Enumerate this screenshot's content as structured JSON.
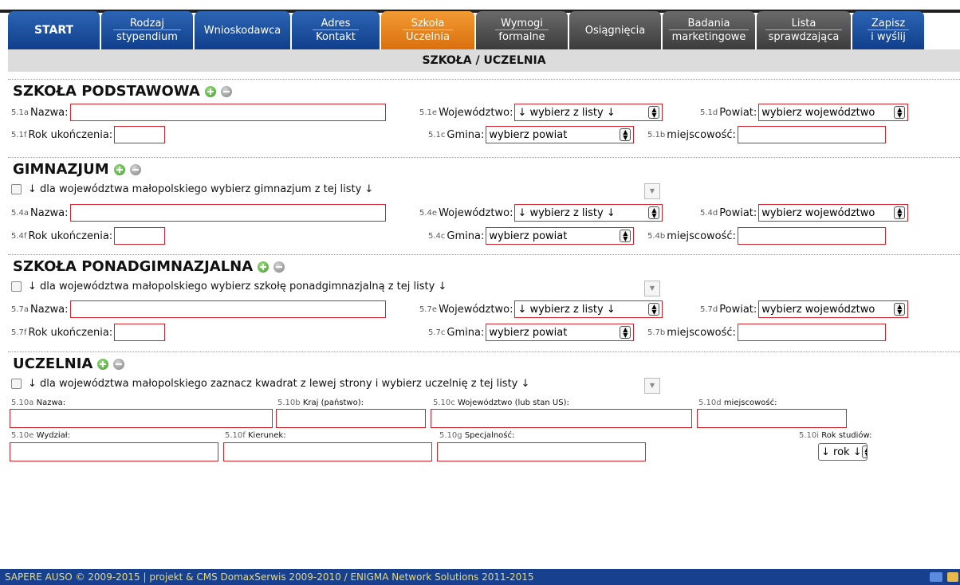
{
  "tabs": [
    {
      "l1": "START",
      "l2": ""
    },
    {
      "l1": "Rodzaj",
      "l2": "stypendium"
    },
    {
      "l1": "Wnioskodawca",
      "l2": ""
    },
    {
      "l1": "Adres",
      "l2": "Kontakt"
    },
    {
      "l1": "Szkoła",
      "l2": "Uczelnia"
    },
    {
      "l1": "Wymogi",
      "l2": "formalne"
    },
    {
      "l1": "Osiągnięcia",
      "l2": ""
    },
    {
      "l1": "Badania",
      "l2": "marketingowe"
    },
    {
      "l1": "Lista",
      "l2": "sprawdzająca"
    },
    {
      "l1": "Zapisz",
      "l2": "i wyślij"
    }
  ],
  "page_title": "SZKOŁA / UCZELNIA",
  "colors": {
    "tab_blue": "#1a4c9c",
    "tab_active": "#e8821f",
    "tab_gray": "#555555",
    "field_border": "#d4232a",
    "footer_bg": "#17408e",
    "footer_text": "#e9d97a"
  },
  "icons": {
    "add": "plus-circle-icon",
    "remove": "minus-circle-icon",
    "dropdown": "chevron-down-icon"
  },
  "sp": {
    "title": "SZKOŁA PODSTAWOWA",
    "nazwa_code": "5.1a",
    "nazwa_label": "Nazwa:",
    "rok_code": "5.1f",
    "rok_label": "Rok ukończenia:",
    "woj_code": "5.1e",
    "woj_label": "Województwo:",
    "woj_value": "↓ wybierz z listy ↓",
    "pow_code": "5.1d",
    "pow_label": "Powiat:",
    "pow_value": "wybierz województwo",
    "gmina_code": "5.1c",
    "gmina_label": "Gmina:",
    "gmina_value": "wybierz powiat",
    "miej_code": "5.1b",
    "miej_label": "miejscowość:"
  },
  "gim": {
    "title": "GIMNAZJUM",
    "hint": "↓ dla województwa małopolskiego wybierz gimnazjum z tej listy ↓",
    "nazwa_code": "5.4a",
    "nazwa_label": "Nazwa:",
    "rok_code": "5.4f",
    "rok_label": "Rok ukończenia:",
    "woj_code": "5.4e",
    "woj_label": "Województwo:",
    "woj_value": "↓ wybierz z listy ↓",
    "pow_code": "5.4d",
    "pow_label": "Powiat:",
    "pow_value": "wybierz województwo",
    "gmina_code": "5.4c",
    "gmina_label": "Gmina:",
    "gmina_value": "wybierz powiat",
    "miej_code": "5.4b",
    "miej_label": "miejscowość:"
  },
  "pon": {
    "title": "SZKOŁA PONADGIMNAZJALNA",
    "hint": "↓ dla województwa małopolskiego wybierz szkołę ponadgimnazjalną z tej listy ↓",
    "nazwa_code": "5.7a",
    "nazwa_label": "Nazwa:",
    "rok_code": "5.7f",
    "rok_label": "Rok ukończenia:",
    "woj_code": "5.7e",
    "woj_label": "Województwo:",
    "woj_value": "↓ wybierz z listy ↓",
    "pow_code": "5.7d",
    "pow_label": "Powiat:",
    "pow_value": "wybierz województwo",
    "gmina_code": "5.7c",
    "gmina_label": "Gmina:",
    "gmina_value": "wybierz powiat",
    "miej_code": "5.7b",
    "miej_label": "miejscowość:"
  },
  "uczelnia": {
    "title": "UCZELNIA",
    "hint": "↓ dla województwa małopolskiego zaznacz kwadrat z lewej strony i wybierz uczelnię z tej listy ↓",
    "nazwa_code": "5.10a",
    "nazwa_label": "Nazwa:",
    "kraj_code": "5.10b",
    "kraj_label": "Kraj (państwo):",
    "woj_code": "5.10c",
    "woj_label": "Województwo (lub stan US):",
    "miej_code": "5.10d",
    "miej_label": "miejscowość:",
    "wydz_code": "5.10e",
    "wydz_label": "Wydział:",
    "kier_code": "5.10f",
    "kier_label": "Kierunek:",
    "spec_code": "5.10g",
    "spec_label": "Specjalność:",
    "rok_code": "5.10i",
    "rok_label": "Rok studiów:",
    "rok_value": "↓ rok ↓"
  },
  "footer": {
    "text": "SAPERE AUSO  © 2009-2015 | projekt & CMS  DomaxSerwis  2009-2010 /  ENIGMA Network Solutions  2011-2015"
  }
}
